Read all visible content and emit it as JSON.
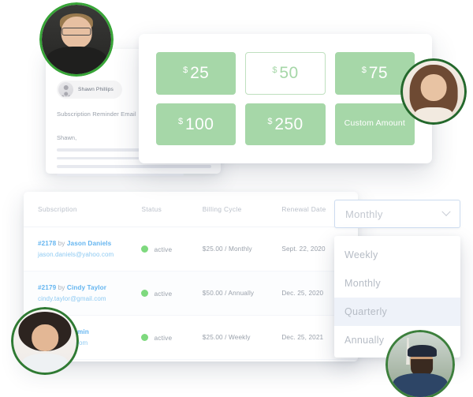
{
  "email_card": {
    "sender_name": "Shawn Phillips",
    "subject": "Subscription Reminder Email",
    "greeting": "Shawn,"
  },
  "amount_card": {
    "currency_symbol": "$",
    "options": [
      {
        "amount": "25",
        "selected": false
      },
      {
        "amount": "50",
        "selected": true
      },
      {
        "amount": "75",
        "selected": false
      },
      {
        "amount": "100",
        "selected": false
      },
      {
        "amount": "250",
        "selected": false
      }
    ],
    "custom_label": "Custom Amount"
  },
  "table": {
    "headers": {
      "subscription": "Subscription",
      "status": "Status",
      "billing_cycle": "Billing Cycle",
      "renewal_date": "Renewal Date"
    },
    "rows": [
      {
        "id": "#2178",
        "by": "by",
        "customer": "Jason Daniels",
        "email": "jason.daniels@yahoo.com",
        "status": "active",
        "billing_cycle": "$25.00 / Monthly",
        "renewal_date": "Sept. 22, 2020"
      },
      {
        "id": "#2179",
        "by": "by",
        "customer": "Cindy Taylor",
        "email": "cindy.taylor@gmail.com",
        "status": "active",
        "billing_cycle": "$50.00 / Annually",
        "renewal_date": "Dec. 25, 2020"
      },
      {
        "id": "",
        "by": "by",
        "customer": "Gill Benjamin",
        "email": "amin@gmail.com",
        "status": "active",
        "billing_cycle": "$25.00 / Weekly",
        "renewal_date": "Dec. 25, 2021"
      }
    ]
  },
  "billing_select": {
    "value": "Monthly",
    "options": [
      {
        "label": "Weekly",
        "highlighted": false
      },
      {
        "label": "Monthly",
        "highlighted": false
      },
      {
        "label": "Quarterly",
        "highlighted": true
      },
      {
        "label": "Annually",
        "highlighted": false
      }
    ]
  },
  "colors": {
    "accent_green": "#a6d7a8",
    "status_green": "#7ed97e",
    "ring_green": "#38a538",
    "link_blue": "#64b5f0",
    "muted_text": "#9aa1ab"
  }
}
